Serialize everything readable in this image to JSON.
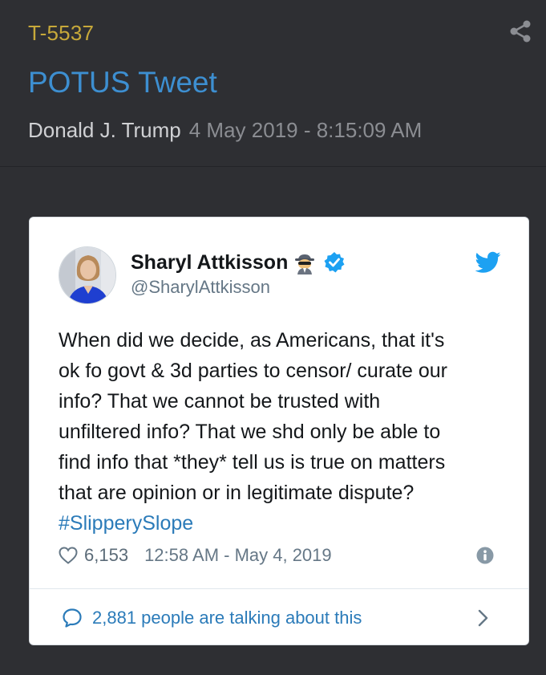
{
  "post": {
    "id": "T-5537",
    "title": "POTUS Tweet",
    "author": "Donald J. Trump",
    "date": "4 May 2019 - 8:15:09 AM",
    "icons": {
      "share": "share-icon"
    }
  },
  "tweet": {
    "display_name": "Sharyl Attkisson",
    "handle": "@SharylAttkisson",
    "lines": [
      "When did we decide, as Americans, that it's",
      "ok fo govt & 3d parties to censor/ curate our",
      "info? That we cannot be trusted with",
      "unfiltered info? That we shd only be able to",
      "find info that *they* tell us is true on matters",
      "that are opinion or in legitimate dispute?"
    ],
    "hashtag": "#SlipperySlope",
    "likes": "6,153",
    "timestamp": "12:58 AM - May 4, 2019",
    "talking": "2,881 people are talking about this",
    "icons": {
      "spy": "spy-emoji-icon",
      "verified": "verified-badge-icon",
      "bird": "twitter-bird-icon",
      "heart": "heart-icon",
      "info": "info-icon",
      "comment": "comment-bubble-icon",
      "chevron": "chevron-right-icon"
    }
  },
  "colors": {
    "background": "#2e2f33",
    "post_id": "#c7a93a",
    "title": "#3d8fd1",
    "link": "#2b7bb9",
    "verified": "#1da1f2"
  }
}
